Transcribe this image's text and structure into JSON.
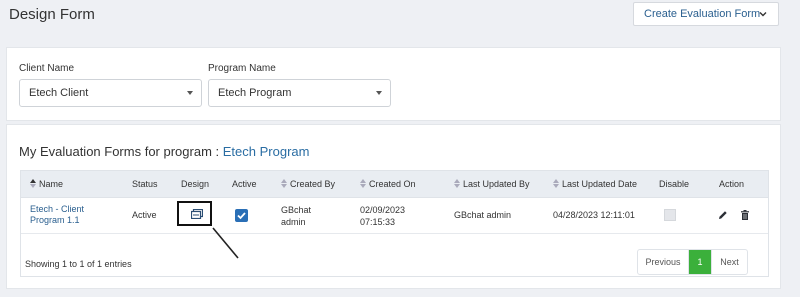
{
  "header": {
    "title": "Design Form",
    "create_button": "Create Evaluation Form"
  },
  "filters": {
    "client_label": "Client Name",
    "client_value": "Etech Client",
    "program_label": "Program Name",
    "program_value": "Etech Program"
  },
  "forms": {
    "title_prefix": "My Evaluation Forms for program :",
    "program": "Etech Program"
  },
  "table": {
    "columns": [
      "Name",
      "Status",
      "Design",
      "Active",
      "Created By",
      "Created On",
      "Last Updated By",
      "Last Updated Date",
      "Disable",
      "Action"
    ],
    "rows": [
      {
        "name_line1": "Etech - Client",
        "name_line2": "Program 1.1",
        "status": "Active",
        "active": true,
        "created_by_line1": "GBchat",
        "created_by_line2": "admin",
        "created_on_line1": "02/09/2023",
        "created_on_line2": "07:15:33",
        "last_updated_by": "GBchat admin",
        "last_updated_date": "04/28/2023 12:11:01",
        "disabled": false
      }
    ]
  },
  "footer": {
    "showing": "Showing 1 to 1 of 1 entries",
    "previous": "Previous",
    "current_page": "1",
    "next": "Next"
  },
  "colors": {
    "accent": "#2a6fb6",
    "page_active": "#3bb03b",
    "link": "#2a5f8f"
  }
}
